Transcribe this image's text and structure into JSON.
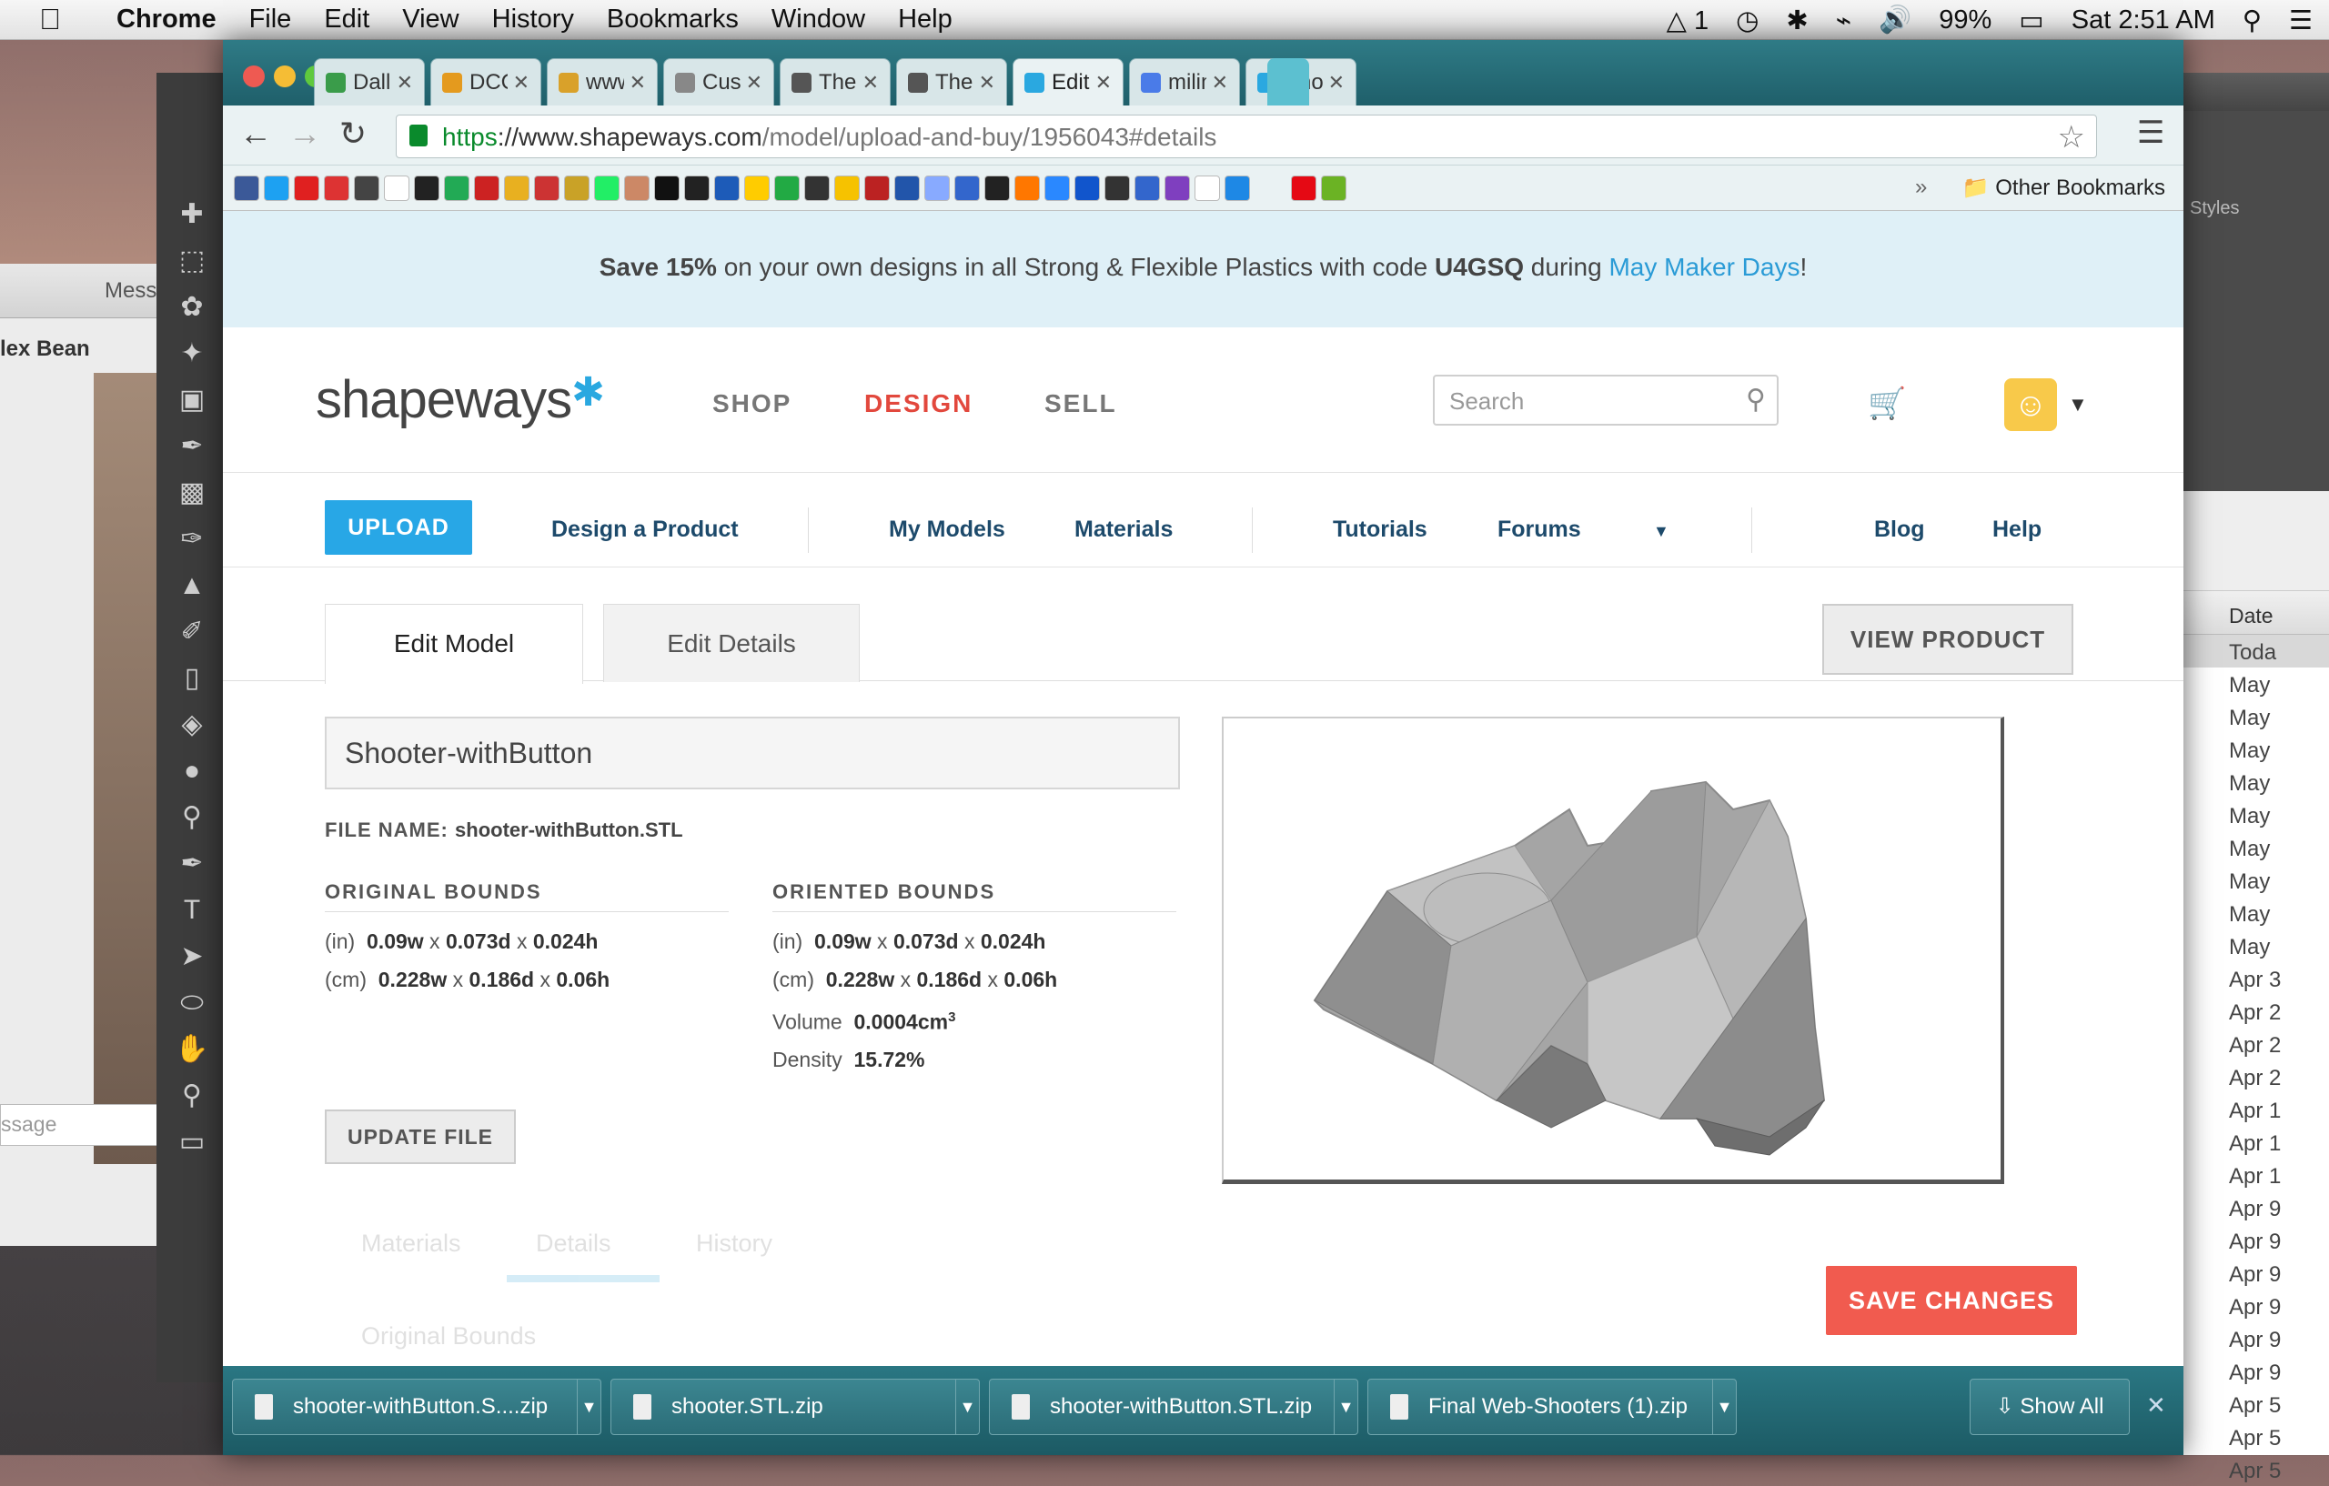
{
  "menubar": {
    "app": "Chrome",
    "items": [
      "File",
      "Edit",
      "View",
      "History",
      "Bookmarks",
      "Window",
      "Help"
    ],
    "status": {
      "adobe": "1",
      "battery": "99%",
      "clock": "Sat 2:51 AM"
    }
  },
  "background": {
    "messages_title": "Mess",
    "contact": "lex Bean",
    "message_placeholder": "ssage",
    "finder_header": "Date",
    "finder_rows": [
      "Toda",
      "May",
      "May",
      "May",
      "May",
      "May",
      "May",
      "May",
      "May",
      "May",
      "Apr 3",
      "Apr 2",
      "Apr 2",
      "Apr 2",
      "Apr 1",
      "Apr 1",
      "Apr 1",
      "Apr 9",
      "Apr 9",
      "Apr 9",
      "Apr 9",
      "Apr 9",
      "Apr 9",
      "Apr 5",
      "Apr 5",
      "Apr 5"
    ],
    "ps_right_label": "Styles"
  },
  "tabs": [
    {
      "title": "Dallas Co",
      "color": "#3a9c4a"
    },
    {
      "title": "DCCCD H",
      "color": "#e49a1e"
    },
    {
      "title": "www.utda",
      "color": "#d9a12a"
    },
    {
      "title": "Custom P",
      "color": "#888888"
    },
    {
      "title": "The Amaz",
      "color": "#555555"
    },
    {
      "title": "The Amaz",
      "color": "#555555"
    },
    {
      "title": "Edit Mode",
      "color": "#2aa8e0"
    },
    {
      "title": "milimeter",
      "color": "#4a7be8"
    },
    {
      "title": "Shooter-v",
      "color": "#2aa8e0"
    }
  ],
  "address": {
    "scheme": "https",
    "host": "://www.shapeways.com",
    "path": "/model/upload-and-buy/1956043#details"
  },
  "bookmarks": {
    "other": "Other Bookmarks"
  },
  "promo": {
    "p1": "Save 15%",
    "p2": " on your own designs in all Strong & Flexible Plastics with code ",
    "p3": "U4GSQ",
    "p4": " during ",
    "p5": "May Maker Days",
    "p6": "!"
  },
  "header": {
    "logo": "shapeways",
    "nav": {
      "shop": "SHOP",
      "design": "DESIGN",
      "sell": "SELL"
    },
    "search_placeholder": "Search"
  },
  "subnav": {
    "upload": "UPLOAD",
    "design_product": "Design a Product",
    "my_models": "My Models",
    "materials": "Materials",
    "tutorials": "Tutorials",
    "forums": "Forums",
    "blog": "Blog",
    "help": "Help"
  },
  "page_tabs": {
    "edit_model": "Edit Model",
    "edit_details": "Edit Details",
    "view_product": "VIEW PRODUCT"
  },
  "model": {
    "name": "Shooter-withButton",
    "file_label": "FILE NAME:",
    "file_name": "shooter-withButton.STL",
    "original_bounds": {
      "title": "ORIGINAL BOUNDS",
      "in_unit": "(in)",
      "in_w": "0.09w",
      "in_d": "0.073d",
      "in_h": "0.024h",
      "cm_unit": "(cm)",
      "cm_w": "0.228w",
      "cm_d": "0.186d",
      "cm_h": "0.06h"
    },
    "oriented_bounds": {
      "title": "ORIENTED BOUNDS",
      "in_unit": "(in)",
      "in_w": "0.09w",
      "in_d": "0.073d",
      "in_h": "0.024h",
      "cm_unit": "(cm)",
      "cm_w": "0.228w",
      "cm_d": "0.186d",
      "cm_h": "0.06h",
      "volume_label": "Volume",
      "volume": "0.0004cm",
      "volume_exp": "3",
      "density_label": "Density",
      "density": "15.72%"
    },
    "update_file": "UPDATE FILE"
  },
  "faded": {
    "materials": "Materials",
    "details": "Details",
    "history": "History",
    "original_bounds": "Original Bounds"
  },
  "save_changes": "SAVE CHANGES",
  "downloads": [
    "shooter-withButton.S....zip",
    "shooter.STL.zip",
    "shooter-withButton.STL.zip",
    "Final Web-Shooters (1).zip"
  ],
  "show_all": "Show All"
}
